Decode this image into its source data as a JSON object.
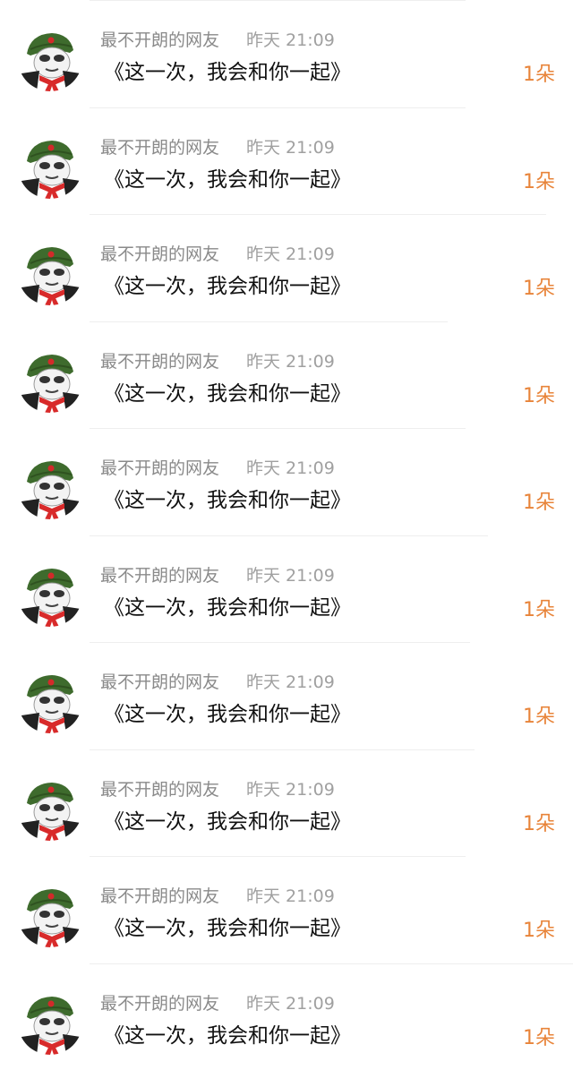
{
  "colors": {
    "name": "#8a8a8a",
    "time": "#a0a0a0",
    "message": "#111111",
    "count": "#e8843a",
    "divider": "#eeeeee"
  },
  "rows": [
    {
      "avatar_icon": "panda-meme-avatar-icon",
      "name": "最不开朗的网友",
      "time": "昨天 21:09",
      "message": "《这一次，我会和你一起》",
      "count": "1朵"
    },
    {
      "avatar_icon": "panda-meme-avatar-icon",
      "name": "最不开朗的网友",
      "time": "昨天 21:09",
      "message": "《这一次，我会和你一起》",
      "count": "1朵"
    },
    {
      "avatar_icon": "panda-meme-avatar-icon",
      "name": "最不开朗的网友",
      "time": "昨天 21:09",
      "message": "《这一次，我会和你一起》",
      "count": "1朵"
    },
    {
      "avatar_icon": "panda-meme-avatar-icon",
      "name": "最不开朗的网友",
      "time": "昨天 21:09",
      "message": "《这一次，我会和你一起》",
      "count": "1朵"
    },
    {
      "avatar_icon": "panda-meme-avatar-icon",
      "name": "最不开朗的网友",
      "time": "昨天 21:09",
      "message": "《这一次，我会和你一起》",
      "count": "1朵"
    },
    {
      "avatar_icon": "panda-meme-avatar-icon",
      "name": "最不开朗的网友",
      "time": "昨天 21:09",
      "message": "《这一次，我会和你一起》",
      "count": "1朵"
    },
    {
      "avatar_icon": "panda-meme-avatar-icon",
      "name": "最不开朗的网友",
      "time": "昨天 21:09",
      "message": "《这一次，我会和你一起》",
      "count": "1朵"
    },
    {
      "avatar_icon": "panda-meme-avatar-icon",
      "name": "最不开朗的网友",
      "time": "昨天 21:09",
      "message": "《这一次，我会和你一起》",
      "count": "1朵"
    },
    {
      "avatar_icon": "panda-meme-avatar-icon",
      "name": "最不开朗的网友",
      "time": "昨天 21:09",
      "message": "《这一次，我会和你一起》",
      "count": "1朵"
    },
    {
      "avatar_icon": "panda-meme-avatar-icon",
      "name": "最不开朗的网友",
      "time": "昨天 21:09",
      "message": "《这一次，我会和你一起》",
      "count": "1朵"
    }
  ]
}
